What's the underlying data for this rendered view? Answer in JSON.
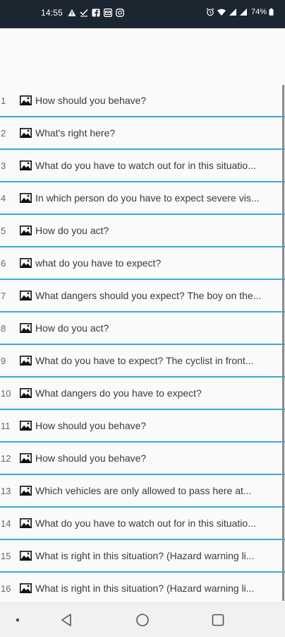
{
  "status_bar": {
    "time": "14:55",
    "battery_text": "74%",
    "left_icons": [
      "warning-icon",
      "check-icon",
      "facebook-icon",
      "email-icon",
      "instagram-icon"
    ],
    "right_icons": [
      "alarm-icon",
      "wifi-icon",
      "signal-icon",
      "signal-icon",
      "battery-icon"
    ]
  },
  "list": {
    "items": [
      {
        "number": "1",
        "text": "How should you behave?"
      },
      {
        "number": "2",
        "text": "What's right here?"
      },
      {
        "number": "3",
        "text": "What do you have to watch out for in this situatio..."
      },
      {
        "number": "4",
        "text": "In which person do you have to expect severe vis..."
      },
      {
        "number": "5",
        "text": "How do you act?"
      },
      {
        "number": "6",
        "text": "what do you have to expect?"
      },
      {
        "number": "7",
        "text": "What dangers should you expect? The boy on the..."
      },
      {
        "number": "8",
        "text": "How do you act?"
      },
      {
        "number": "9",
        "text": "What do you have to expect? The cyclist in front..."
      },
      {
        "number": "10",
        "text": "What dangers do you have to expect?"
      },
      {
        "number": "11",
        "text": "How should you behave?"
      },
      {
        "number": "12",
        "text": "How should you behave?"
      },
      {
        "number": "13",
        "text": "Which vehicles are only allowed to pass here at..."
      },
      {
        "number": "14",
        "text": "What do you have to watch out for in this situatio..."
      },
      {
        "number": "15",
        "text": "What is right in this situation? (Hazard warning li..."
      },
      {
        "number": "16",
        "text": "What is right in this situation? (Hazard warning li..."
      }
    ],
    "item_icon": "image-icon",
    "divider_color": "#3aa9dc"
  },
  "nav_bar": {
    "buttons": [
      "menu-dot-icon",
      "back-icon",
      "home-icon",
      "recents-icon"
    ]
  }
}
